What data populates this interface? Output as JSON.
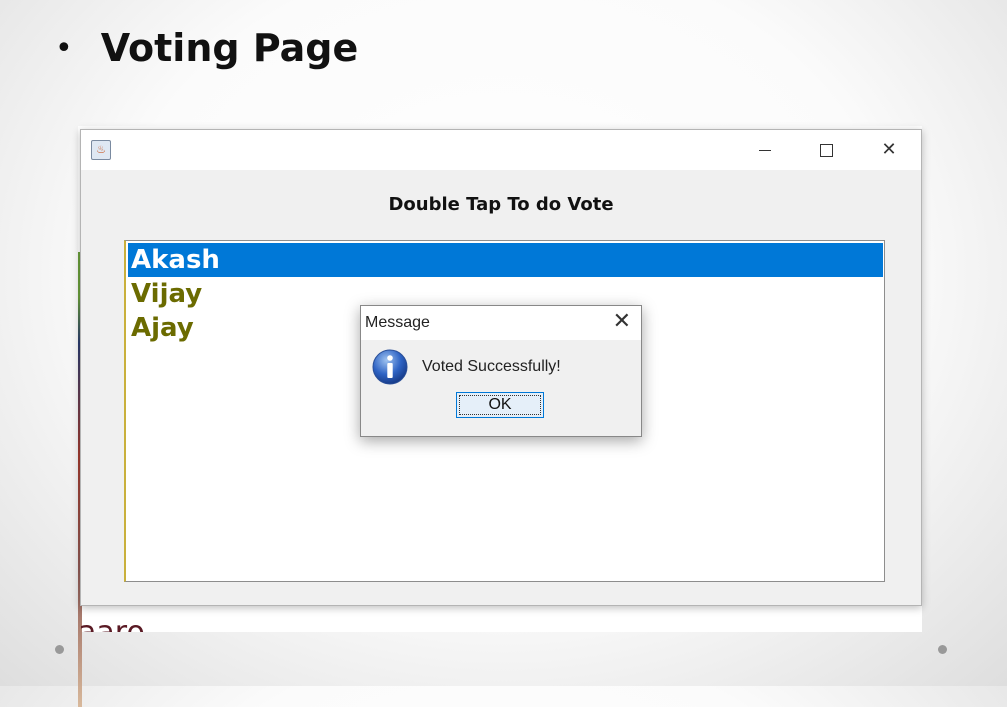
{
  "slide": {
    "bullet": "•",
    "title": "Voting Page"
  },
  "background_app": {
    "cut_text": "aaro"
  },
  "window": {
    "header_label": "Double Tap To do Vote",
    "icons": {
      "app": "java-app-icon",
      "minimize": "minimize-icon",
      "maximize": "maximize-icon",
      "close": "close-icon"
    }
  },
  "candidates": {
    "items": [
      {
        "name": "Akash",
        "selected": true
      },
      {
        "name": "Vijay",
        "selected": false
      },
      {
        "name": "Ajay",
        "selected": false
      }
    ],
    "selected_color": "#0078d7",
    "item_color": "#6b6b00"
  },
  "dialog": {
    "title": "Message",
    "close_glyph": "✕",
    "message": "Voted Successfully!",
    "ok_label": "OK",
    "icon": "info-icon"
  }
}
